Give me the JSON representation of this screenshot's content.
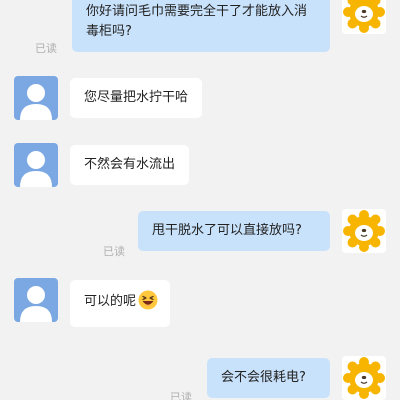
{
  "messages": [
    {
      "side": "out",
      "text": "你好请问毛巾需要完全干了才能放入消毒柜吗?",
      "status": "已读"
    },
    {
      "side": "in",
      "text": "您尽量把水拧干哈"
    },
    {
      "side": "in",
      "text": "不然会有水流出"
    },
    {
      "side": "out",
      "text": "甩干脱水了可以直接放吗?",
      "status": "已读"
    },
    {
      "side": "in",
      "text": "可以的呢",
      "emoji": "grinning-squint-face"
    },
    {
      "side": "out",
      "text": "会不会很耗电?",
      "status": "已读"
    }
  ],
  "colors": {
    "background": "#f2f2f2",
    "outgoing_bubble": "#c9e2fb",
    "incoming_bubble": "#ffffff",
    "agent_avatar_bg": "#7ba7e2",
    "user_avatar_sun": "#f7b500",
    "read_status": "#b0b0b0"
  },
  "icons": {
    "agent_avatar": "person-silhouette-icon",
    "user_avatar": "sun-lion-mascot-icon"
  }
}
